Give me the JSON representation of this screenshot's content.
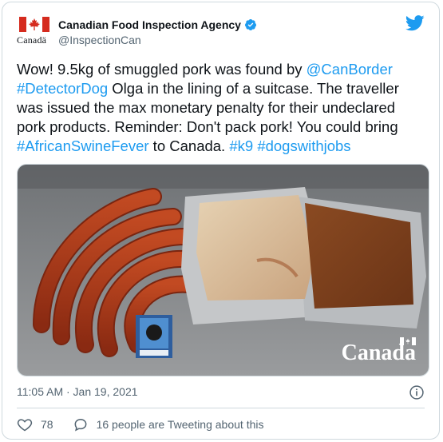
{
  "account": {
    "display_name": "Canadian Food Inspection Agency",
    "handle": "@InspectionCan",
    "logo_wordmark": "Canadä",
    "verified": true
  },
  "tweet": {
    "segments": [
      {
        "text": "Wow! 9.5kg of smuggled pork was found by ",
        "type": "text"
      },
      {
        "text": "@CanBorder",
        "type": "link"
      },
      {
        "text": " ",
        "type": "text"
      },
      {
        "text": "#DetectorDog",
        "type": "link"
      },
      {
        "text": " Olga in the lining of a suitcase. The traveller was issued the max monetary penalty for their undeclared pork products. Reminder: Don't pack pork! You could bring ",
        "type": "text"
      },
      {
        "text": "#AfricanSwineFever",
        "type": "link"
      },
      {
        "text": " to Canada. ",
        "type": "text"
      },
      {
        "text": "#k9",
        "type": "link"
      },
      {
        "text": " ",
        "type": "text"
      },
      {
        "text": "#dogswithjobs",
        "type": "link"
      }
    ],
    "image_watermark": "Canada",
    "timestamp": "11:05 AM · Jan 19, 2021"
  },
  "actions": {
    "likes": "78",
    "conversation": "16 people are Tweeting about this"
  },
  "colors": {
    "link": "#1d9bf0",
    "twitter_blue": "#1d9bf0",
    "canada_red": "#d52b1e",
    "muted": "#536471"
  },
  "icons": [
    "maple-leaf-icon",
    "verified-badge-icon",
    "twitter-bird-icon",
    "info-icon",
    "heart-icon",
    "chat-bubble-icon"
  ]
}
